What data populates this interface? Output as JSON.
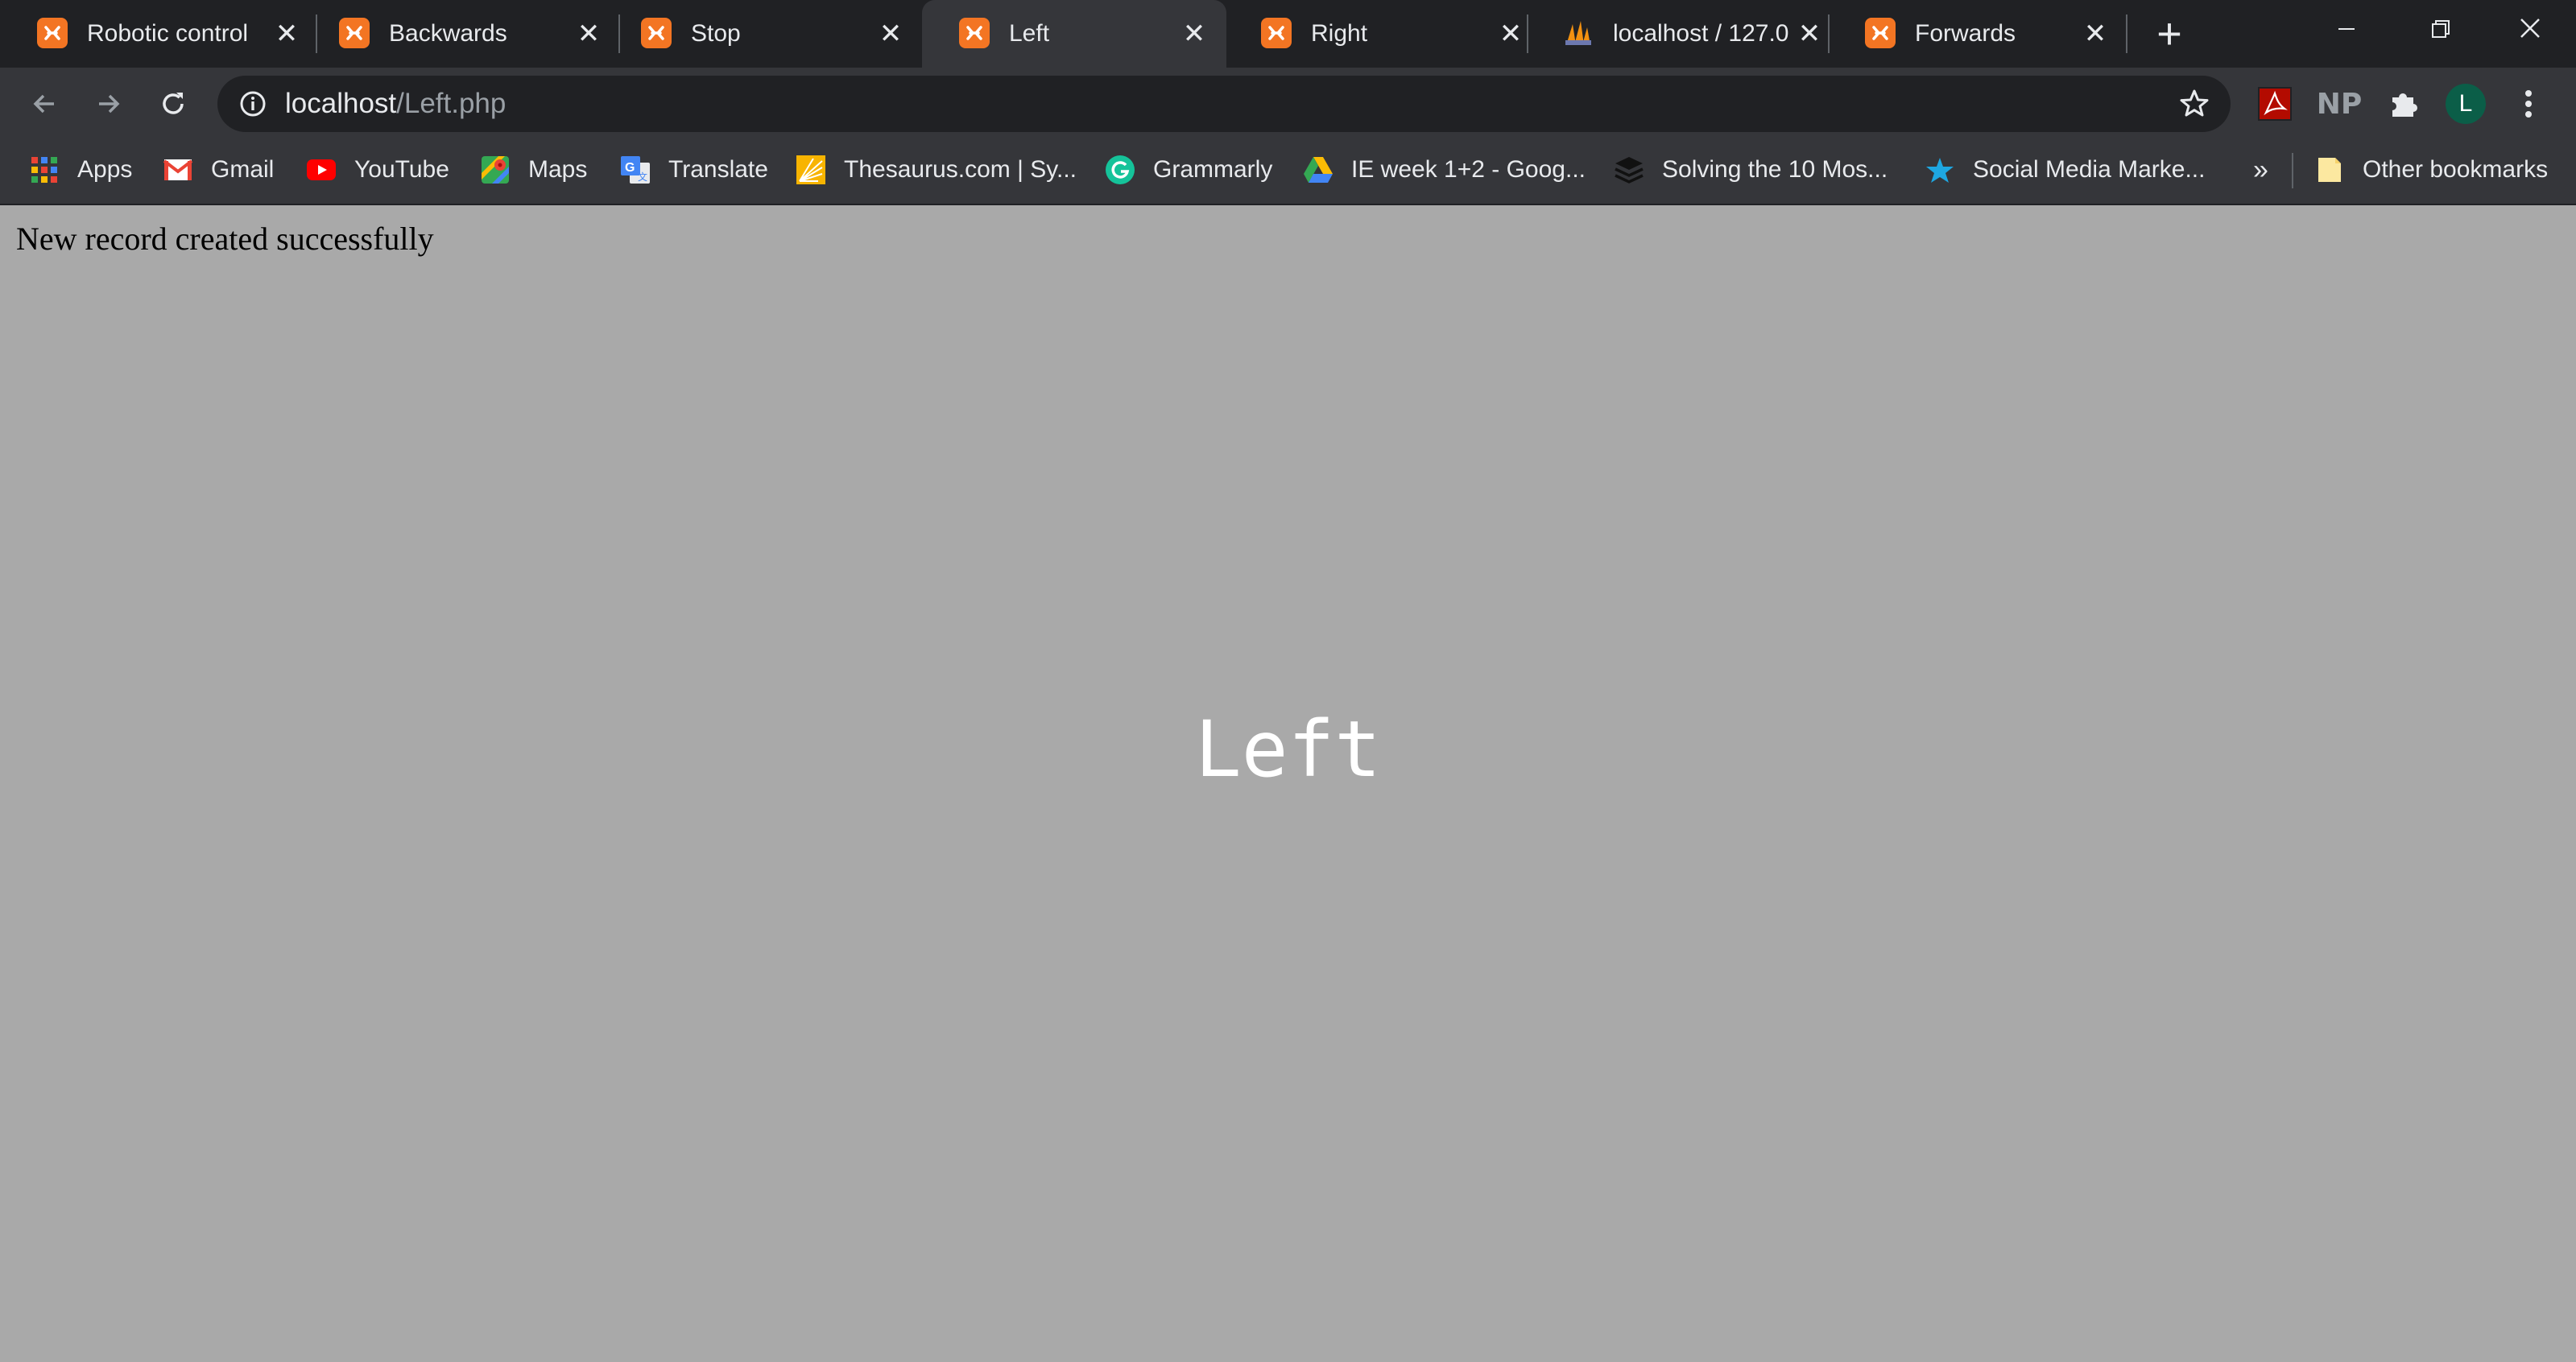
{
  "tabs": [
    {
      "title": "Robotic control",
      "favicon": "xampp-icon",
      "active": false
    },
    {
      "title": "Backwards",
      "favicon": "xampp-icon",
      "active": false
    },
    {
      "title": "Stop",
      "favicon": "xampp-icon",
      "active": false
    },
    {
      "title": "Left",
      "favicon": "xampp-icon",
      "active": true
    },
    {
      "title": "Right",
      "favicon": "xampp-icon",
      "active": false
    },
    {
      "title": "localhost / 127.0",
      "favicon": "phpmyadmin-icon",
      "active": false
    },
    {
      "title": "Forwards",
      "favicon": "xampp-icon",
      "active": false
    }
  ],
  "address_bar": {
    "host": "localhost",
    "path": "/Left.php"
  },
  "profile": {
    "initial": "L",
    "color": "#0b5e48"
  },
  "extensions": {
    "np_label": "NP"
  },
  "bookmarks": [
    {
      "label": "Apps",
      "icon": "apps-grid-icon"
    },
    {
      "label": "Gmail",
      "icon": "gmail-icon"
    },
    {
      "label": "YouTube",
      "icon": "youtube-icon"
    },
    {
      "label": "Maps",
      "icon": "maps-icon"
    },
    {
      "label": "Translate",
      "icon": "translate-icon"
    },
    {
      "label": "Thesaurus.com | Sy...",
      "icon": "thesaurus-icon"
    },
    {
      "label": "Grammarly",
      "icon": "grammarly-icon"
    },
    {
      "label": "IE week 1+2 - Goog...",
      "icon": "google-drive-icon"
    },
    {
      "label": "Solving the 10 Mos...",
      "icon": "layers-icon"
    },
    {
      "label": "Social Media Marke...",
      "icon": "star-icon"
    }
  ],
  "bookmarks_overflow": "»",
  "other_bookmarks": "Other bookmarks",
  "page": {
    "message": "New record created successfully",
    "direction": "Left"
  },
  "colors": {
    "xampp_orange": "#f37523",
    "page_background": "#a9a9a9",
    "titlebar": "#202124",
    "toolbar": "#35363a"
  }
}
